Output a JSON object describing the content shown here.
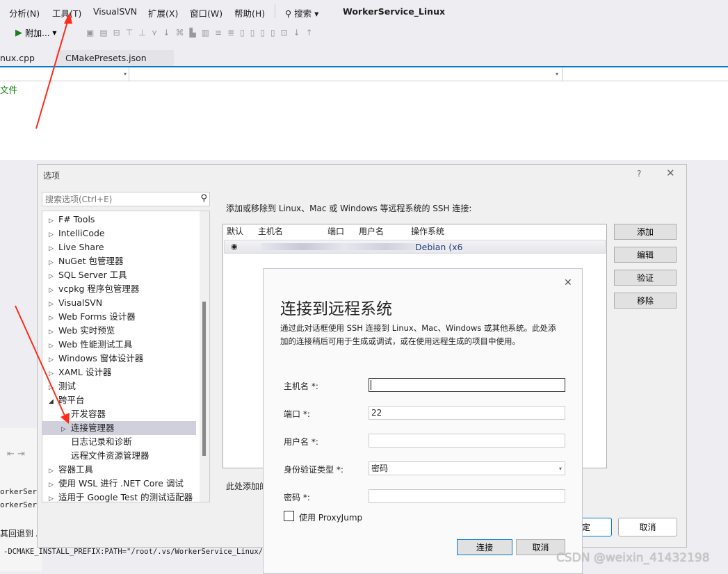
{
  "menu": {
    "items": [
      "分析(N)",
      "工具(T)",
      "VisualSVN",
      "扩展(X)",
      "窗口(W)",
      "帮助(H)"
    ],
    "search": "搜索",
    "title": "WorkerService_Linux"
  },
  "toolbar": {
    "attach": "附加..."
  },
  "tabs": [
    "nux.cpp",
    "CMakePresets.json"
  ],
  "editor": {
    "text": "文件"
  },
  "output": {
    "lines": [
      "orkerServi",
      "orkerServi",
      "其回退到 。",
      "-DCMAKE_INSTALL_PREFIX:PATH=\"/root/.vs/WorkerService_Linux/out/"
    ]
  },
  "options": {
    "title": "选项",
    "help": "?",
    "search_placeholder": "搜索选项(Ctrl+E)",
    "tree": [
      {
        "label": "F# Tools",
        "arrow": "▷"
      },
      {
        "label": "IntelliCode",
        "arrow": "▷"
      },
      {
        "label": "Live Share",
        "arrow": "▷"
      },
      {
        "label": "NuGet 包管理器",
        "arrow": "▷"
      },
      {
        "label": "SQL Server 工具",
        "arrow": "▷"
      },
      {
        "label": "vcpkg 程序包管理器",
        "arrow": "▷"
      },
      {
        "label": "VisualSVN",
        "arrow": "▷"
      },
      {
        "label": "Web Forms 设计器",
        "arrow": "▷"
      },
      {
        "label": "Web 实时预览",
        "arrow": "▷"
      },
      {
        "label": "Web 性能测试工具",
        "arrow": "▷"
      },
      {
        "label": "Windows 窗体设计器",
        "arrow": "▷"
      },
      {
        "label": "XAML 设计器",
        "arrow": "▷"
      },
      {
        "label": "测试",
        "arrow": "▷"
      },
      {
        "label": "跨平台",
        "arrow": "◢"
      },
      {
        "label": "开发容器",
        "arrow": "",
        "indent": true
      },
      {
        "label": "连接管理器",
        "arrow": "▷",
        "indent": true,
        "selected": true
      },
      {
        "label": "日志记录和诊断",
        "arrow": "",
        "indent": true
      },
      {
        "label": "远程文件资源管理器",
        "arrow": "",
        "indent": true
      },
      {
        "label": "容器工具",
        "arrow": "▷"
      },
      {
        "label": "使用 WSL 进行 .NET Core 调试",
        "arrow": "▷"
      },
      {
        "label": "适用于 Google Test 的测试适配器",
        "arrow": "▷"
      }
    ],
    "heading": "添加或移除到 Linux、Mac 或 Windows 等远程系统的 SSH 连接:",
    "columns": [
      "默认",
      "主机名",
      "端口",
      "用户名",
      "操作系统"
    ],
    "row": {
      "os": "Debian (x6"
    },
    "buttons": [
      "添加",
      "编辑",
      "验证",
      "移除"
    ],
    "note": "此处添加的",
    "ok": "定",
    "cancel": "取消"
  },
  "connect": {
    "title": "连接到远程系统",
    "desc1": "通过此对话框使用 SSH 连接到 Linux、Mac、Windows 或其他系统。此处添",
    "desc2": "加的连接稍后可用于生成或调试，或在使用远程生成的项目中使用。",
    "fields": [
      {
        "label": "主机名 *:",
        "value": ""
      },
      {
        "label": "端口 *:",
        "value": "22"
      },
      {
        "label": "用户名 *:",
        "value": ""
      },
      {
        "label": "身份验证类型 *:",
        "value": "密码"
      },
      {
        "label": "密码 *:",
        "value": ""
      }
    ],
    "proxy": "使用 ProxyJump",
    "proxy_checked": false,
    "connect": "连接",
    "cancel": "取消"
  },
  "watermark": "CSDN @weixin_41432198",
  "colors": {
    "accent": "#007acc",
    "arrow": "#ff2a1a",
    "editor_text": "#008000"
  }
}
